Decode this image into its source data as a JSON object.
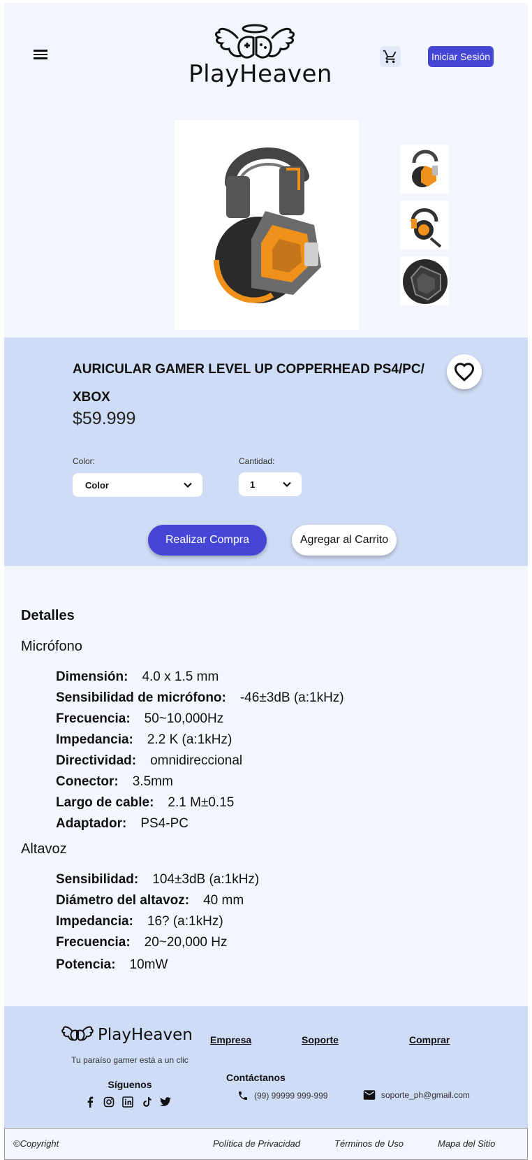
{
  "header": {
    "menu_icon": "hamburger-menu-icon",
    "logo_text": "PlayHeaven",
    "cart_icon": "shopping-cart-icon",
    "login_label": "Iniciar Sesión",
    "accent_color": "#4545d6"
  },
  "gallery": {
    "main_image": "headset-image",
    "thumbnails": [
      "headset-thumb-1",
      "headset-thumb-2",
      "headset-thumb-3"
    ]
  },
  "product": {
    "title": "AURICULAR GAMER LEVEL UP COPPERHEAD PS4/PC/ XBOX",
    "price": "$59.999",
    "favorite_icon": "heart-icon",
    "color_label": "Color:",
    "color_value": "Color",
    "quantity_label": "Cantidad:",
    "quantity_value": "1",
    "buy_label": "Realizar Compra",
    "add_to_cart_label": "Agregar al Carrito",
    "panel_color": "#cfdcf5"
  },
  "details": {
    "heading": "Detalles",
    "microphone": {
      "title": "Micrófono",
      "specs": [
        {
          "label": "Dimensión:",
          "value": "4.0 x 1.5 mm"
        },
        {
          "label": "Sensibilidad de micrófono:",
          "value": "-46±3dB (a:1kHz)"
        },
        {
          "label": "Frecuencia:",
          "value": "50~10,000Hz"
        },
        {
          "label": "Impedancia:",
          "value": "2.2 K (a:1kHz)"
        },
        {
          "label": "Directividad:",
          "value": "omnidireccional"
        },
        {
          "label": "Conector:",
          "value": "3.5mm"
        },
        {
          "label": "Largo de cable:",
          "value": "2.1 M±0.15"
        },
        {
          "label": "Adaptador:",
          "value": "PS4-PC"
        }
      ]
    },
    "speaker": {
      "title": "Altavoz",
      "specs": [
        {
          "label": "Sensibilidad:",
          "value": "104±3dB (a:1kHz)"
        },
        {
          "label": "Diámetro del altavoz:",
          "value": "40 mm"
        },
        {
          "label": "Impedancia:",
          "value": "16? (a:1kHz)"
        },
        {
          "label": "Frecuencia:",
          "value": "20~20,000 Hz"
        },
        {
          "label": "Potencia:",
          "value": "10mW"
        }
      ]
    }
  },
  "footer": {
    "logo_text": "PlayHeaven",
    "tagline": "Tu paraíso gamer está a un clic",
    "follow_label": "Síguenos",
    "socials": [
      "facebook-icon",
      "instagram-icon",
      "linkedin-icon",
      "tiktok-icon",
      "twitter-icon"
    ],
    "links": [
      "Empresa",
      "Soporte",
      "Comprar"
    ],
    "contact_label": "Contáctanos",
    "phone": "(99) 99999 999-999",
    "email": "soporte_ph@gmail.com"
  },
  "bottom_bar": {
    "copyright": "©Copyright",
    "privacy": "Política de Privacidad",
    "terms": "Términos de Uso",
    "sitemap": "Mapa del Sitio"
  }
}
